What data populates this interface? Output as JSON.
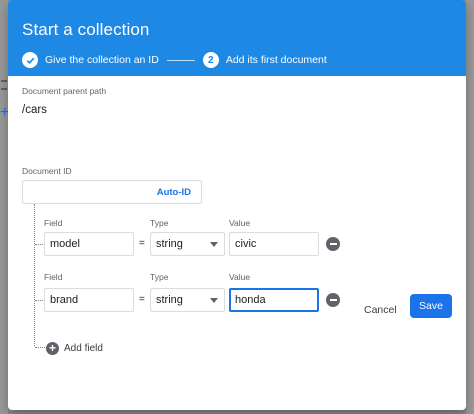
{
  "dialog": {
    "title": "Start a collection",
    "steps": [
      {
        "label": "Give the collection an ID",
        "state": "done"
      },
      {
        "number": "2",
        "label": "Add its first document",
        "state": "active"
      }
    ]
  },
  "parent_path": {
    "label": "Document parent path",
    "value": "/cars"
  },
  "document_id": {
    "label": "Document ID",
    "value": "",
    "auto_id_label": "Auto-ID"
  },
  "columns": {
    "field": "Field",
    "type": "Type",
    "value": "Value"
  },
  "fields": [
    {
      "field": "model",
      "equals": "=",
      "type": "string",
      "value": "civic"
    },
    {
      "field": "brand",
      "equals": "=",
      "type": "string",
      "value": "honda"
    }
  ],
  "add_field_label": "Add field",
  "actions": {
    "cancel": "Cancel",
    "save": "Save"
  },
  "colors": {
    "header": "#1e88e5",
    "accent": "#1a73e8"
  }
}
